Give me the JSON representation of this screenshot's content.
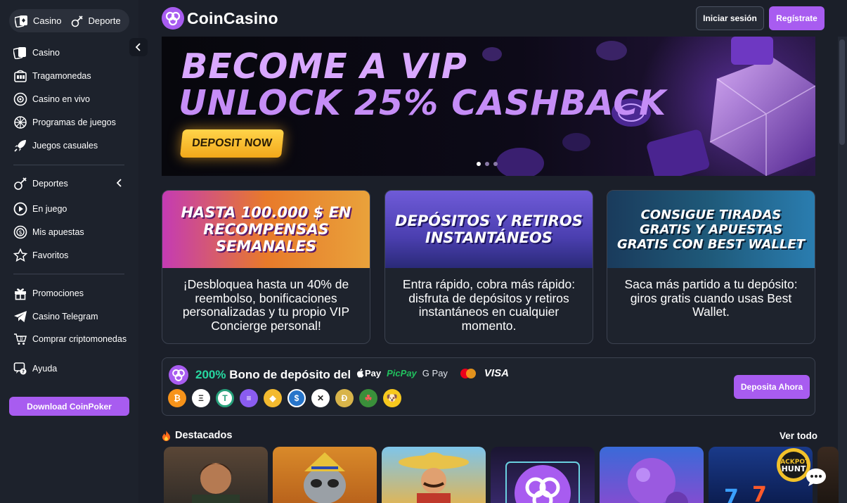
{
  "sidebar": {
    "mode_switch": {
      "casino": "Casino",
      "sports": "Deportes"
    },
    "casino_items": [
      {
        "label": "Casino",
        "icon": "cards-icon"
      },
      {
        "label": "Tragamonedas",
        "icon": "slot-machine-icon"
      },
      {
        "label": "Casino en vivo",
        "icon": "live-casino-icon"
      },
      {
        "label": "Programas de juegos",
        "icon": "game-show-icon"
      },
      {
        "label": "Juegos casuales",
        "icon": "rocket-icon"
      }
    ],
    "sports_items": [
      {
        "label": "Deportes",
        "icon": "sports-icon"
      },
      {
        "label": "En juego",
        "icon": "play-icon"
      },
      {
        "label": "Mis apuestas",
        "icon": "coin-bet-icon"
      },
      {
        "label": "Favoritos",
        "icon": "star-icon"
      }
    ],
    "other_items": [
      {
        "label": "Promociones",
        "icon": "gift-icon"
      },
      {
        "label": "Casino Telegram",
        "icon": "telegram-icon"
      },
      {
        "label": "Comprar criptomonedas",
        "icon": "buy-crypto-icon"
      },
      {
        "label": "Ayuda",
        "icon": "help-icon"
      }
    ],
    "download_button": "Download CoinPoker"
  },
  "header": {
    "logo": "CoinCasino",
    "login": "Iniciar sesión",
    "register": "Regístrate"
  },
  "hero": {
    "line1": "BECOME A VIP",
    "line2": "UNLOCK 25% CASHBACK",
    "cta": "DEPOSIT NOW",
    "slides": 3,
    "active_slide": 1
  },
  "promo_cards": [
    {
      "banner": "HASTA 100.000 $ EN RECOMPENSAS SEMANALES",
      "text": "¡Desbloquea hasta un 40% de reembolso, bonificaciones personalizadas y tu propio VIP Concierge personal!"
    },
    {
      "banner": "DEPÓSITOS Y RETIROS INSTANTÁNEOS",
      "text": "Entra rápido, cobra más rápido: disfruta de depósitos y retiros instantáneos en cualquier momento."
    },
    {
      "banner": "CONSIGUE TIRADAS GRATIS Y APUESTAS GRATIS CON BEST WALLET",
      "text": "Saca más partido a tu depósito: giros gratis cuando usas Best Wallet."
    }
  ],
  "bonus": {
    "percent": "200%",
    "title": "Bono de depósito del",
    "payments": [
      "Pay",
      "PicPay",
      "G Pay",
      "VISA"
    ],
    "coins": [
      "₿",
      "Ξ",
      "T",
      "≡",
      "◆",
      "$",
      "✕",
      "Ð",
      "☘",
      "🐶"
    ],
    "cta": "Deposita Ahora"
  },
  "featured": {
    "title": "Destacados",
    "see_all": "Ver todo"
  },
  "colors": {
    "accent": "#a85cf0",
    "bonus_green": "#27d8a0",
    "background": "#1b1f29"
  }
}
